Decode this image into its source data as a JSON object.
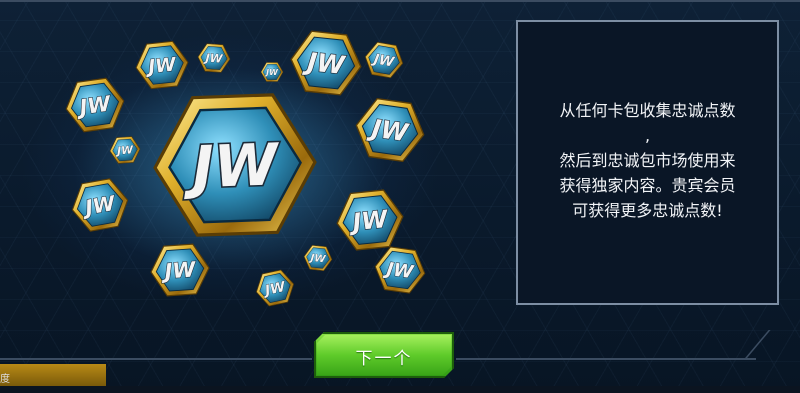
{
  "info": {
    "lines": [
      "从任何卡包收集忠诚点数",
      ",",
      "然后到忠诚包市场使用来",
      "获得独家内容。贵宾会员",
      "可获得更多忠诚点数!"
    ]
  },
  "buttons": {
    "next_label": "下一个"
  },
  "corner": {
    "tab_text": "度"
  },
  "medals": {
    "logo_text": "JW"
  },
  "colors": {
    "gold": "#d9a824",
    "teal": "#2f8fb8",
    "button_green": "#52c022",
    "panel_border": "#7d8ea3"
  }
}
